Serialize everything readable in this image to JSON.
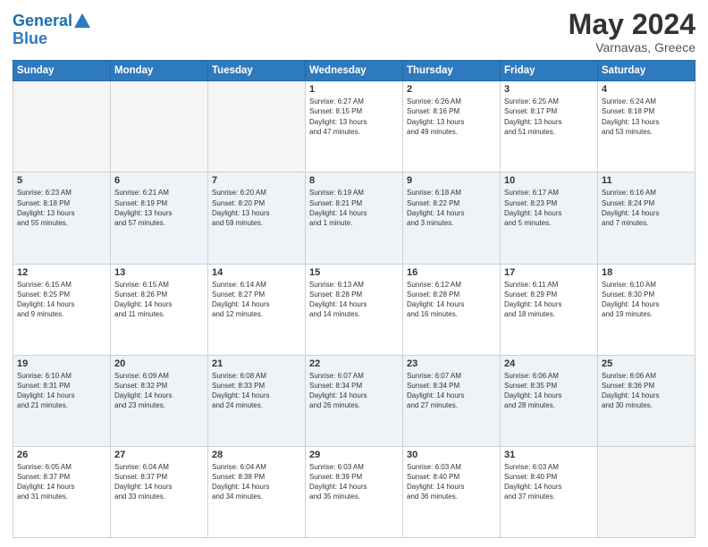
{
  "header": {
    "logo_line1": "General",
    "logo_line2": "Blue",
    "title": "May 2024",
    "location": "Varnavas, Greece"
  },
  "days_of_week": [
    "Sunday",
    "Monday",
    "Tuesday",
    "Wednesday",
    "Thursday",
    "Friday",
    "Saturday"
  ],
  "weeks": [
    [
      {
        "day": "",
        "info": ""
      },
      {
        "day": "",
        "info": ""
      },
      {
        "day": "",
        "info": ""
      },
      {
        "day": "1",
        "info": "Sunrise: 6:27 AM\nSunset: 8:15 PM\nDaylight: 13 hours\nand 47 minutes."
      },
      {
        "day": "2",
        "info": "Sunrise: 6:26 AM\nSunset: 8:16 PM\nDaylight: 13 hours\nand 49 minutes."
      },
      {
        "day": "3",
        "info": "Sunrise: 6:25 AM\nSunset: 8:17 PM\nDaylight: 13 hours\nand 51 minutes."
      },
      {
        "day": "4",
        "info": "Sunrise: 6:24 AM\nSunset: 8:18 PM\nDaylight: 13 hours\nand 53 minutes."
      }
    ],
    [
      {
        "day": "5",
        "info": "Sunrise: 6:23 AM\nSunset: 8:18 PM\nDaylight: 13 hours\nand 55 minutes."
      },
      {
        "day": "6",
        "info": "Sunrise: 6:21 AM\nSunset: 8:19 PM\nDaylight: 13 hours\nand 57 minutes."
      },
      {
        "day": "7",
        "info": "Sunrise: 6:20 AM\nSunset: 8:20 PM\nDaylight: 13 hours\nand 59 minutes."
      },
      {
        "day": "8",
        "info": "Sunrise: 6:19 AM\nSunset: 8:21 PM\nDaylight: 14 hours\nand 1 minute."
      },
      {
        "day": "9",
        "info": "Sunrise: 6:18 AM\nSunset: 8:22 PM\nDaylight: 14 hours\nand 3 minutes."
      },
      {
        "day": "10",
        "info": "Sunrise: 6:17 AM\nSunset: 8:23 PM\nDaylight: 14 hours\nand 5 minutes."
      },
      {
        "day": "11",
        "info": "Sunrise: 6:16 AM\nSunset: 8:24 PM\nDaylight: 14 hours\nand 7 minutes."
      }
    ],
    [
      {
        "day": "12",
        "info": "Sunrise: 6:15 AM\nSunset: 8:25 PM\nDaylight: 14 hours\nand 9 minutes."
      },
      {
        "day": "13",
        "info": "Sunrise: 6:15 AM\nSunset: 8:26 PM\nDaylight: 14 hours\nand 11 minutes."
      },
      {
        "day": "14",
        "info": "Sunrise: 6:14 AM\nSunset: 8:27 PM\nDaylight: 14 hours\nand 12 minutes."
      },
      {
        "day": "15",
        "info": "Sunrise: 6:13 AM\nSunset: 8:28 PM\nDaylight: 14 hours\nand 14 minutes."
      },
      {
        "day": "16",
        "info": "Sunrise: 6:12 AM\nSunset: 8:28 PM\nDaylight: 14 hours\nand 16 minutes."
      },
      {
        "day": "17",
        "info": "Sunrise: 6:11 AM\nSunset: 8:29 PM\nDaylight: 14 hours\nand 18 minutes."
      },
      {
        "day": "18",
        "info": "Sunrise: 6:10 AM\nSunset: 8:30 PM\nDaylight: 14 hours\nand 19 minutes."
      }
    ],
    [
      {
        "day": "19",
        "info": "Sunrise: 6:10 AM\nSunset: 8:31 PM\nDaylight: 14 hours\nand 21 minutes."
      },
      {
        "day": "20",
        "info": "Sunrise: 6:09 AM\nSunset: 8:32 PM\nDaylight: 14 hours\nand 23 minutes."
      },
      {
        "day": "21",
        "info": "Sunrise: 6:08 AM\nSunset: 8:33 PM\nDaylight: 14 hours\nand 24 minutes."
      },
      {
        "day": "22",
        "info": "Sunrise: 6:07 AM\nSunset: 8:34 PM\nDaylight: 14 hours\nand 26 minutes."
      },
      {
        "day": "23",
        "info": "Sunrise: 6:07 AM\nSunset: 8:34 PM\nDaylight: 14 hours\nand 27 minutes."
      },
      {
        "day": "24",
        "info": "Sunrise: 6:06 AM\nSunset: 8:35 PM\nDaylight: 14 hours\nand 28 minutes."
      },
      {
        "day": "25",
        "info": "Sunrise: 6:06 AM\nSunset: 8:36 PM\nDaylight: 14 hours\nand 30 minutes."
      }
    ],
    [
      {
        "day": "26",
        "info": "Sunrise: 6:05 AM\nSunset: 8:37 PM\nDaylight: 14 hours\nand 31 minutes."
      },
      {
        "day": "27",
        "info": "Sunrise: 6:04 AM\nSunset: 8:37 PM\nDaylight: 14 hours\nand 33 minutes."
      },
      {
        "day": "28",
        "info": "Sunrise: 6:04 AM\nSunset: 8:38 PM\nDaylight: 14 hours\nand 34 minutes."
      },
      {
        "day": "29",
        "info": "Sunrise: 6:03 AM\nSunset: 8:39 PM\nDaylight: 14 hours\nand 35 minutes."
      },
      {
        "day": "30",
        "info": "Sunrise: 6:03 AM\nSunset: 8:40 PM\nDaylight: 14 hours\nand 36 minutes."
      },
      {
        "day": "31",
        "info": "Sunrise: 6:03 AM\nSunset: 8:40 PM\nDaylight: 14 hours\nand 37 minutes."
      },
      {
        "day": "",
        "info": ""
      }
    ]
  ]
}
